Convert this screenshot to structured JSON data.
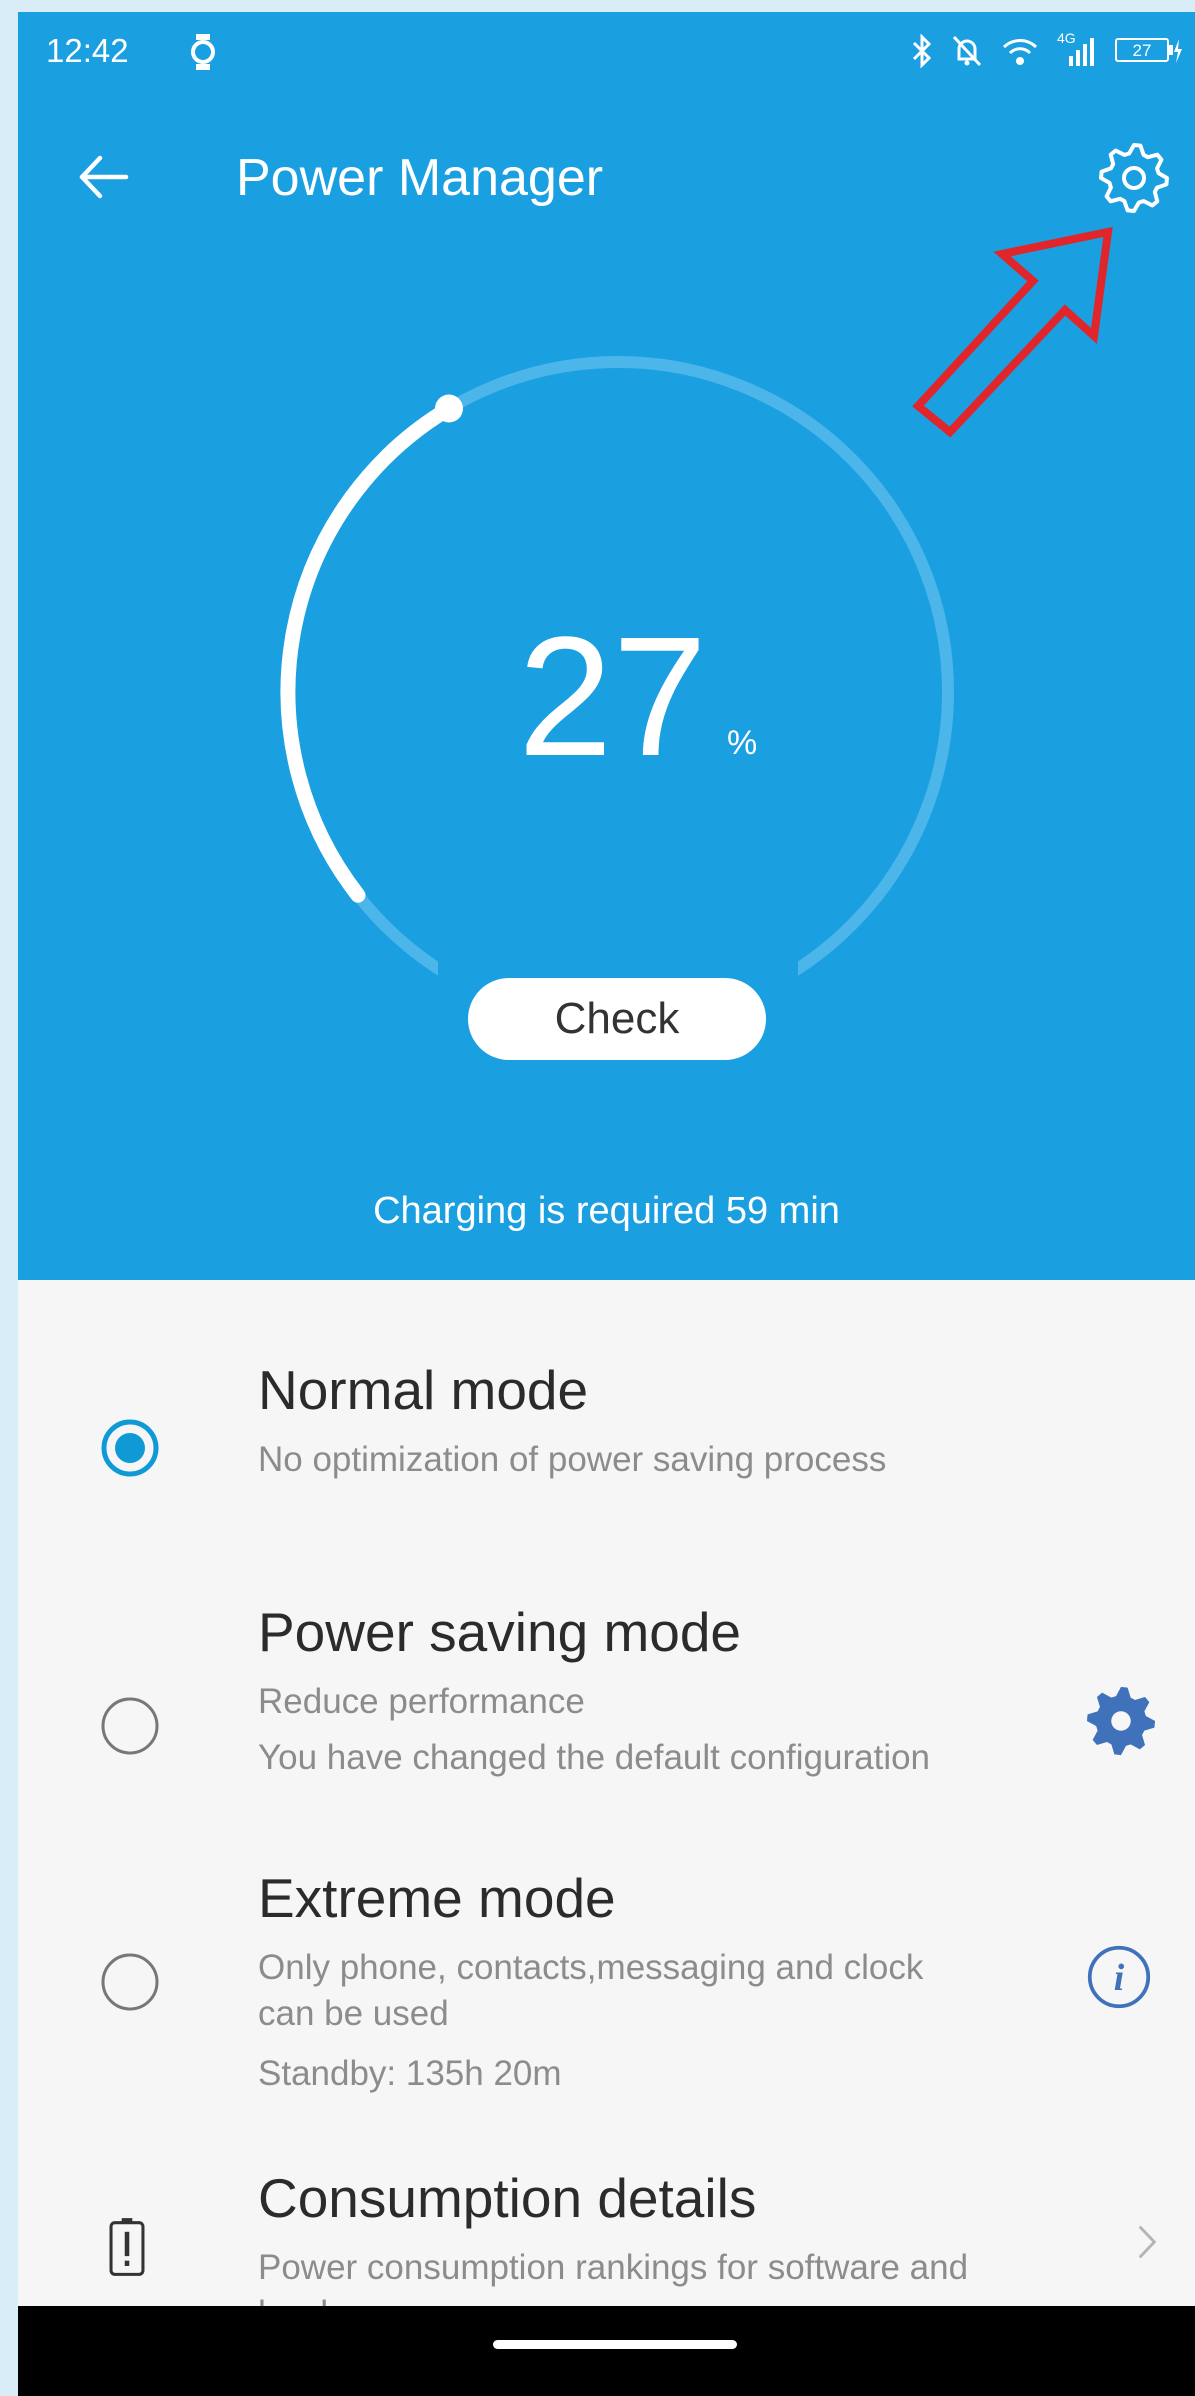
{
  "status_bar": {
    "time": "12:42",
    "signal": "4G",
    "battery_level": "27",
    "icons": [
      "watch-icon",
      "bluetooth-icon",
      "muted-bell-icon",
      "wifi-icon",
      "signal-icon",
      "battery-charging-icon"
    ]
  },
  "app_bar": {
    "title": "Power Manager",
    "back_icon": "back-arrow-icon",
    "settings_icon": "gear-icon"
  },
  "annotation": {
    "icon": "red-arrow-pointer",
    "color": "#e0262b"
  },
  "gauge": {
    "value": "27",
    "unit": "%",
    "fraction": 0.27,
    "check_label": "Check",
    "charging_text": "Charging is required 59 min"
  },
  "modes": [
    {
      "title": "Normal mode",
      "lines": [
        "No optimization of power saving process"
      ],
      "selected": true
    },
    {
      "title": "Power saving mode",
      "lines": [
        "Reduce performance",
        "You have changed the default configuration"
      ],
      "selected": false,
      "side_icon": "gear-settings-icon"
    },
    {
      "title": "Extreme mode",
      "lines": [
        "Only phone, contacts,messaging and clock",
        "can be used",
        "Standby: 135h 20m"
      ],
      "selected": false,
      "side_icon": "info-icon"
    }
  ],
  "consumption": {
    "title": "Consumption details",
    "lines": [
      "Power consumption rankings for software and",
      "hardware"
    ],
    "icon": "battery-alert-icon",
    "chevron_icon": "chevron-right-icon"
  },
  "colors": {
    "primary": "#1a9fe0",
    "accent": "#0f9ad6",
    "side_icon": "#3f72ba",
    "arrow": "#e0262b"
  }
}
